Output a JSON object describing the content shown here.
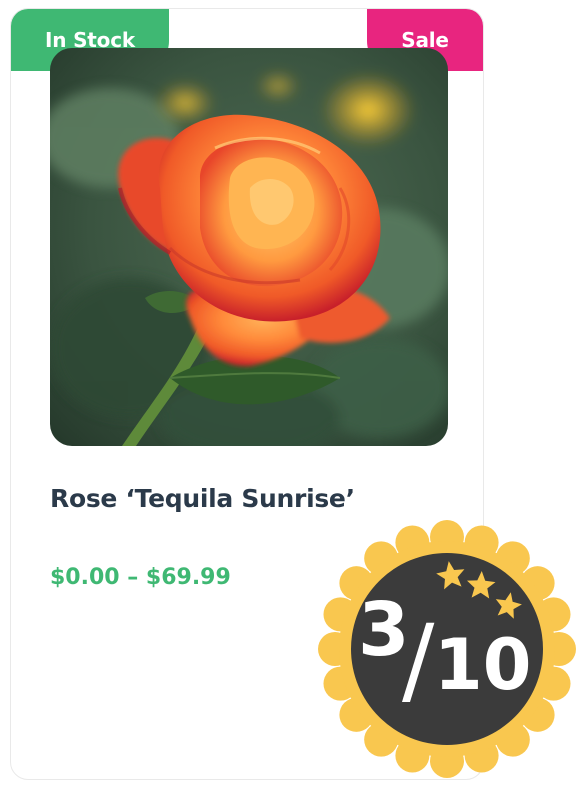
{
  "product": {
    "stock_badge": "In Stock",
    "sale_badge": "Sale",
    "title": "Rose ‘Tequila Sunrise’",
    "price_range": "$0.00 – $69.99",
    "image_subject": "orange-red rose flower"
  },
  "rating": {
    "score": "3",
    "separator": "/",
    "max": "10",
    "stars_icon": "three-stars-icon"
  },
  "colors": {
    "in_stock": "#3fb873",
    "sale": "#e8257f",
    "title": "#2b3a4a",
    "price": "#3fb873",
    "seal_outer": "#f9c74f",
    "seal_inner": "#3b3b3b",
    "stars": "#f9c74f"
  }
}
